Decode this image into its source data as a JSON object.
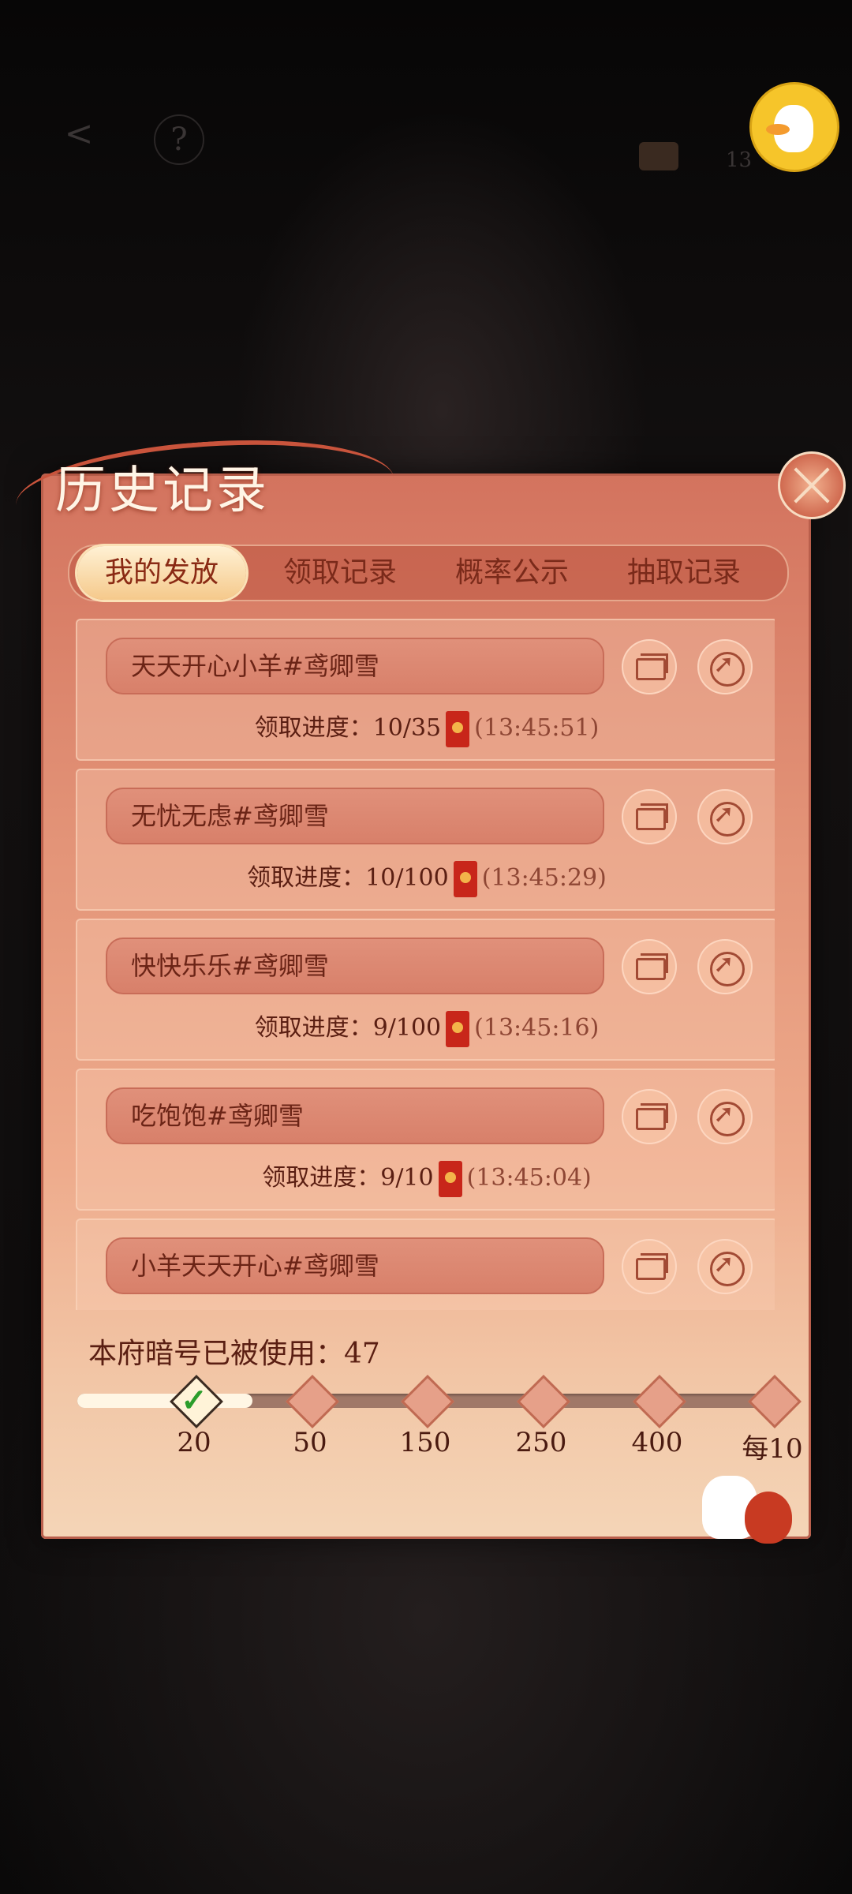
{
  "topbar": {
    "back": "<",
    "help": "?",
    "count": "13"
  },
  "panel": {
    "title": "历史记录"
  },
  "tabs": [
    {
      "label": "我的发放",
      "active": true
    },
    {
      "label": "领取记录",
      "active": false
    },
    {
      "label": "概率公示",
      "active": false
    },
    {
      "label": "抽取记录",
      "active": false
    }
  ],
  "records": [
    {
      "name": "天天开心小羊#鸢卿雪",
      "progress_label": "领取进度：",
      "progress": "10/35",
      "time": "(13:45:51)"
    },
    {
      "name": "无忧无虑#鸢卿雪",
      "progress_label": "领取进度：",
      "progress": "10/100",
      "time": "(13:45:29)"
    },
    {
      "name": "快快乐乐#鸢卿雪",
      "progress_label": "领取进度：",
      "progress": "9/100",
      "time": "(13:45:16)"
    },
    {
      "name": "吃饱饱#鸢卿雪",
      "progress_label": "领取进度：",
      "progress": "9/10",
      "time": "(13:45:04)"
    },
    {
      "name": "小羊天天开心#鸢卿雪",
      "progress_label": "",
      "progress": "",
      "time": ""
    }
  ],
  "footer": {
    "used_text": "本府暗号已被使用：47",
    "used_count": 47,
    "milestones": [
      "20",
      "50",
      "150",
      "250",
      "400",
      "每10"
    ],
    "completed_milestones": 1
  },
  "colors": {
    "accent": "#c8261a",
    "panel": "#e39478",
    "tab_active": "#f5c98b"
  }
}
